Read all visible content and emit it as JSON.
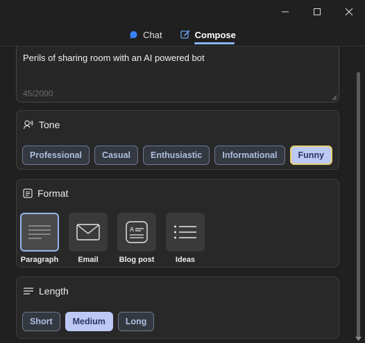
{
  "window": {
    "controls": {
      "minimize": "minimize-icon",
      "maximize": "maximize-icon",
      "close": "close-icon"
    }
  },
  "tabs": [
    {
      "label": "Chat",
      "icon": "chat-bubble-icon",
      "active": false
    },
    {
      "label": "Compose",
      "icon": "compose-pencil-icon",
      "active": true
    }
  ],
  "prompt": {
    "value": "Perils of sharing room with an AI powered bot",
    "counter": "45/2000"
  },
  "tone": {
    "title": "Tone",
    "icon": "tone-voice-icon",
    "options": [
      "Professional",
      "Casual",
      "Enthusiastic",
      "Informational",
      "Funny"
    ],
    "selected": "Funny"
  },
  "format": {
    "title": "Format",
    "icon": "format-icon",
    "options": [
      {
        "label": "Paragraph",
        "icon": "paragraph-icon"
      },
      {
        "label": "Email",
        "icon": "email-icon"
      },
      {
        "label": "Blog post",
        "icon": "blog-post-icon"
      },
      {
        "label": "Ideas",
        "icon": "ideas-list-icon"
      }
    ],
    "selected": "Paragraph"
  },
  "length": {
    "title": "Length",
    "icon": "length-lines-icon",
    "options": [
      "Short",
      "Medium",
      "Long"
    ],
    "selected": "Medium"
  },
  "colors": {
    "background": "#202020",
    "card": "#282828",
    "accent": "#8ab4f8",
    "chip_selected": "#bcc9f5",
    "focus_ring": "#e8cf6e"
  }
}
